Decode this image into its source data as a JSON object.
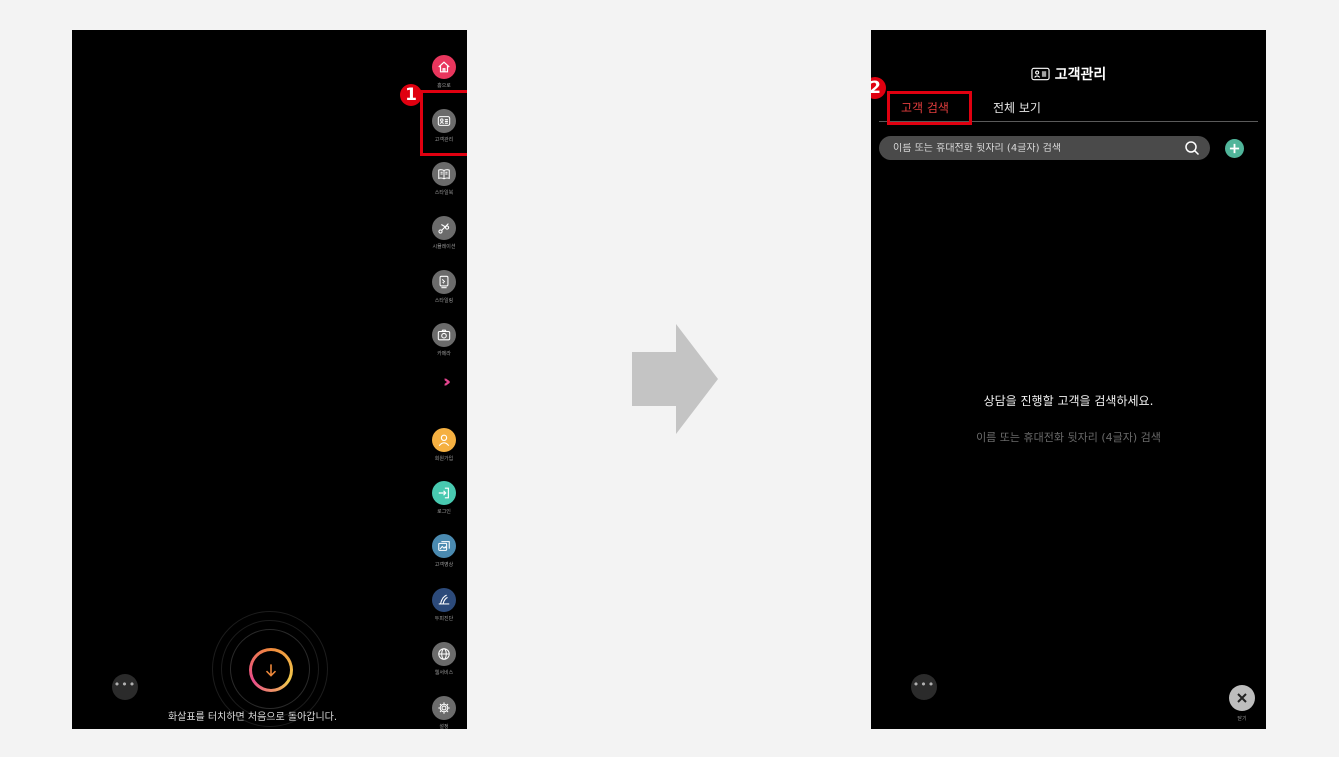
{
  "left_screen": {
    "rail_items": [
      {
        "label": "홈으로",
        "icon": "home-icon",
        "color": "#e8365d"
      },
      {
        "label": "고객관리",
        "icon": "customer-card-icon",
        "color": "#6b6b6b"
      },
      {
        "label": "스타일북",
        "icon": "book-icon",
        "color": "#6b6b6b"
      },
      {
        "label": "시뮬레이션",
        "icon": "scissors-icon",
        "color": "#6b6b6b"
      },
      {
        "label": "스타일링",
        "icon": "mirror-icon",
        "color": "#6b6b6b"
      },
      {
        "label": "카메라",
        "icon": "camera-icon",
        "color": "#6b6b6b"
      },
      {
        "label": "회원가입",
        "icon": "person-icon",
        "color": "#f5b041"
      },
      {
        "label": "로그인",
        "icon": "login-icon",
        "color": "#48c9b0"
      },
      {
        "label": "고객영상",
        "icon": "video-gallery-icon",
        "color": "#4a8ab0"
      },
      {
        "label": "두피진단",
        "icon": "scalp-icon",
        "color": "#2c4a7a"
      },
      {
        "label": "웹서비스",
        "icon": "globe-icon",
        "color": "#6b6b6b"
      },
      {
        "label": "설정",
        "icon": "gear-icon",
        "color": "#6b6b6b"
      }
    ],
    "expand_icon": "double-chevron-right-icon",
    "step_badge": "1",
    "more_label": "•••",
    "home_hint": "화살표를 터치하면 처음으로 돌아갑니다.",
    "accent_color": "#e00010"
  },
  "right_screen": {
    "title": "고객관리",
    "title_icon": "customer-card-icon",
    "step_badge": "2",
    "tabs": [
      {
        "label": "고객 검색",
        "active": true
      },
      {
        "label": "전체 보기",
        "active": false
      }
    ],
    "search": {
      "placeholder": "이름 또는 휴대전화 뒷자리 (4글자) 검색",
      "value": ""
    },
    "empty_title": "상담을 진행할 고객을 검색하세요.",
    "empty_subtitle": "이름 또는 휴대전화 뒷자리 (4글자) 검색",
    "more_label": "•••",
    "close_label": "닫기",
    "active_tab_color": "#e33d3d",
    "add_button_color": "#50b59a"
  }
}
